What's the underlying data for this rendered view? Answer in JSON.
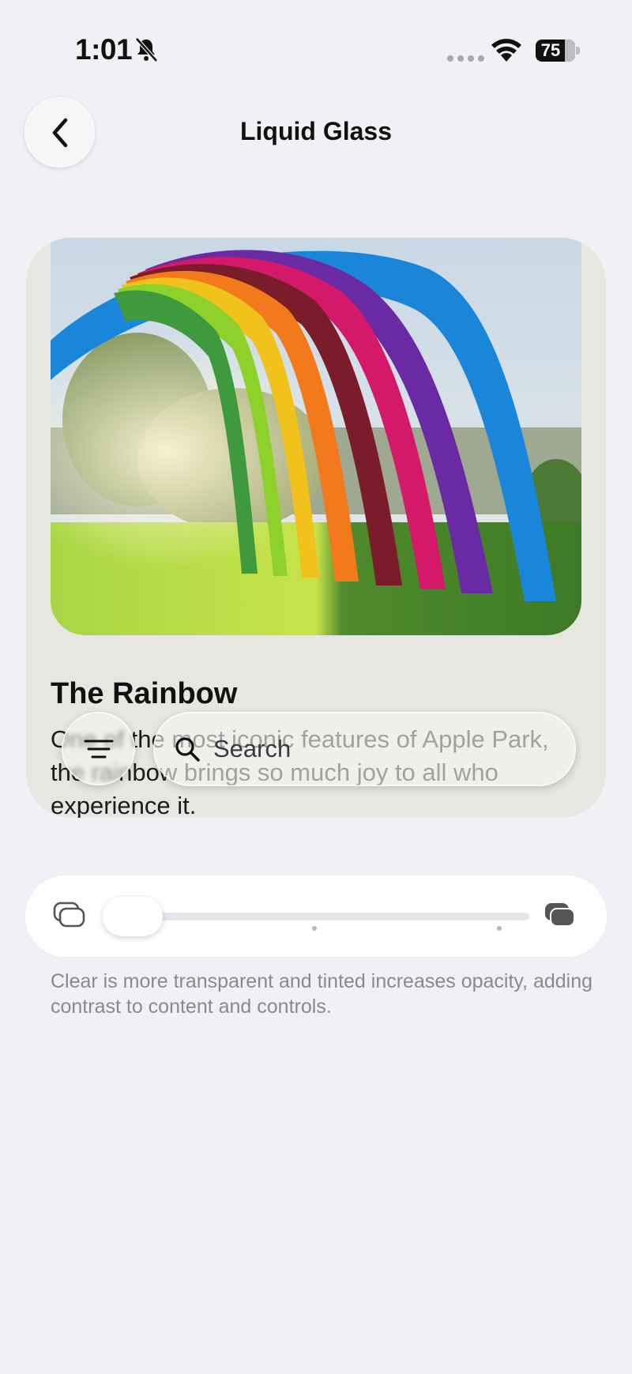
{
  "status_bar": {
    "time": "1:01",
    "battery": "75",
    "icons": [
      "bell-slash-icon",
      "wifi-icon",
      "battery-icon"
    ]
  },
  "nav": {
    "title": "Liquid Glass",
    "back_icon": "chevron-left-icon"
  },
  "card": {
    "title": "The Rainbow",
    "body": "One of the most iconic features of Apple Park, the rainbow brings so much joy to all who experience it.",
    "image_icon": "rainbow-photo"
  },
  "toolbar": {
    "menu_icon": "line-3-horizontal-icon",
    "search_placeholder": "Search",
    "search_icon": "magnifying-glass-icon"
  },
  "appearance_slider": {
    "left_icon": "clear-glass-icon",
    "right_icon": "tinted-glass-icon",
    "value": 0,
    "caption": "Clear is more transparent and tinted increases opacity, adding contrast to content and controls."
  },
  "colors": {
    "background": "#f1f1f5",
    "card": "#e8e6e1",
    "caption": "#8a8a8e"
  }
}
